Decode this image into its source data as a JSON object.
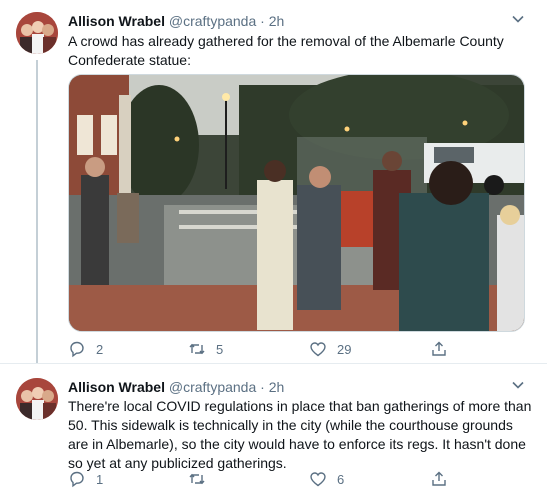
{
  "tweets": [
    {
      "author_name": "Allison Wrabel",
      "handle": "@craftypanda",
      "separator": "·",
      "time": "2h",
      "text": "A crowd has already gathered for the removal of the Albemarle County Confederate statue:",
      "replies": "2",
      "retweets": "5",
      "likes": "29"
    },
    {
      "author_name": "Allison Wrabel",
      "handle": "@craftypanda",
      "separator": "·",
      "time": "2h",
      "text": "There're local COVID regulations in place that ban gatherings of more than 50. This sidewalk is technically in the city (while the courthouse grounds are in Albemarle), so the city would have to enforce its regs. It hasn't done so yet at any publicized gatherings.",
      "replies": "1",
      "retweets": "",
      "likes": "6"
    }
  ],
  "icons": {
    "reply": "reply-icon",
    "retweet": "retweet-icon",
    "like": "like-icon",
    "share": "share-icon",
    "caret": "chevron-down-icon"
  },
  "colors": {
    "text": "#0f1419",
    "muted": "#5b7083",
    "thread_line": "#c4cfd6"
  }
}
